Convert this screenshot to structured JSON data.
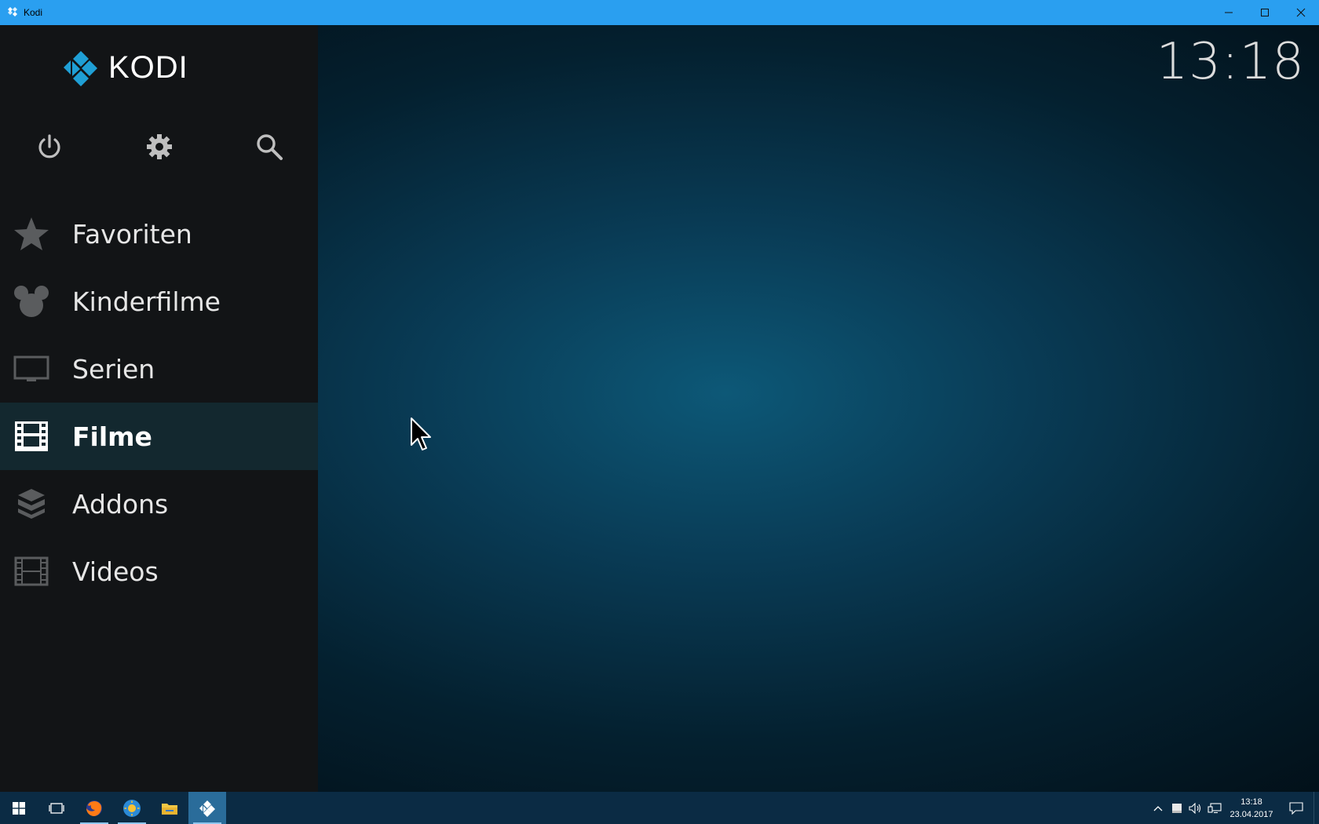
{
  "window": {
    "title": "Kodi",
    "controls": [
      "minimize-icon",
      "maximize-icon",
      "close-icon"
    ]
  },
  "logo": {
    "text": "KODI"
  },
  "clock": "13:18",
  "top_icons": [
    "power-icon",
    "settings-gear-icon",
    "search-icon"
  ],
  "menu": {
    "items": [
      {
        "label": "Favoriten",
        "icon": "star-icon",
        "selected": false
      },
      {
        "label": "Kinderfilme",
        "icon": "mouse-ears-icon",
        "selected": false
      },
      {
        "label": "Serien",
        "icon": "tv-icon",
        "selected": false
      },
      {
        "label": "Filme",
        "icon": "filmstrip-icon",
        "selected": true
      },
      {
        "label": "Addons",
        "icon": "addon-box-icon",
        "selected": false
      },
      {
        "label": "Videos",
        "icon": "video-frames-icon",
        "selected": false
      }
    ]
  },
  "taskbar": {
    "apps": [
      "windows-start-icon",
      "task-view-icon",
      "firefox-icon",
      "weather-app-icon",
      "file-explorer-icon",
      "kodi-icon"
    ],
    "tray_icons": [
      "chevron-up-icon",
      "tray-app-icon",
      "volume-icon",
      "network-icon"
    ],
    "time": "13:18",
    "date": "23.04.2017"
  },
  "colors": {
    "titlebar": "#2a9ff0",
    "sidebar": "#121416",
    "selected_row": "#13282f",
    "kodi_blue": "#1f9fd5",
    "taskbar": "#0b2b44"
  }
}
